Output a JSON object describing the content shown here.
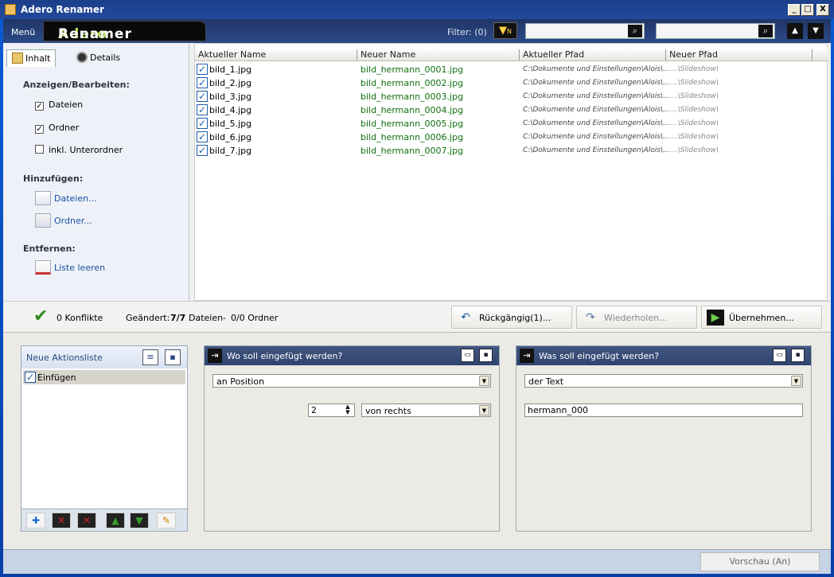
{
  "window": {
    "title": "Adero Renamer",
    "minimize": "_",
    "maximize": "□",
    "close": "X"
  },
  "topbar": {
    "menu": "Menü",
    "logo_a": "Adero",
    "logo_b": "Renamer",
    "filter_label": "Filter: (0)",
    "filter_icon": "N"
  },
  "left": {
    "tab_content": "Inhalt",
    "tab_details": "Details",
    "show_edit": "Anzeigen/Bearbeiten:",
    "checks": [
      {
        "label": "Dateien",
        "checked": "✓"
      },
      {
        "label": "Ordner",
        "checked": "✓"
      },
      {
        "label": "inkl. Unterordner",
        "checked": ""
      }
    ],
    "add": "Hinzufügen:",
    "add_files": "Dateien...",
    "add_folder": "Ordner...",
    "remove": "Entfernen:",
    "clear_list": "Liste leeren"
  },
  "table": {
    "headers": [
      "Aktueller Name",
      "Neuer Name",
      "Aktueller Pfad",
      "Neuer Pfad"
    ],
    "rows": [
      {
        "cur": "bild_1.jpg",
        "new": "bild_hermann_0001.jpg",
        "path": "C:\\Dokumente und Einstellungen\\Alois\\...",
        "npath": "...\\Slideshow\\"
      },
      {
        "cur": "bild_2.jpg",
        "new": "bild_hermann_0002.jpg",
        "path": "C:\\Dokumente und Einstellungen\\Alois\\...",
        "npath": "...\\Slideshow\\"
      },
      {
        "cur": "bild_3.jpg",
        "new": "bild_hermann_0003.jpg",
        "path": "C:\\Dokumente und Einstellungen\\Alois\\...",
        "npath": "...\\Slideshow\\"
      },
      {
        "cur": "bild_4.jpg",
        "new": "bild_hermann_0004.jpg",
        "path": "C:\\Dokumente und Einstellungen\\Alois\\...",
        "npath": "...\\Slideshow\\"
      },
      {
        "cur": "bild_5.jpg",
        "new": "bild_hermann_0005.jpg",
        "path": "C:\\Dokumente und Einstellungen\\Alois\\...",
        "npath": "...\\Slideshow\\"
      },
      {
        "cur": "bild_6.jpg",
        "new": "bild_hermann_0006.jpg",
        "path": "C:\\Dokumente und Einstellungen\\Alois\\...",
        "npath": "...\\Slideshow\\"
      },
      {
        "cur": "bild_7.jpg",
        "new": "bild_hermann_0007.jpg",
        "path": "C:\\Dokumente und Einstellungen\\Alois\\...",
        "npath": "...\\Slideshow\\"
      }
    ]
  },
  "status": {
    "conflicts": "0 Konflikte",
    "changed_label": "Geändert:",
    "changed_files_count": "7/7",
    "changed_files_word": "Dateien",
    "sep": "-",
    "changed_folders": "0/0 Ordner",
    "undo": "Rückgängig(1)...",
    "redo": "Wiederholen...",
    "apply": "Übernehmen..."
  },
  "actions": {
    "title": "Neue Aktionsliste",
    "item": "Einfügen"
  },
  "where": {
    "title": "Wo soll eingefügt werden?",
    "position": "an Position",
    "number": "2",
    "direction": "von rechts"
  },
  "what": {
    "title": "Was soll eingefügt werden?",
    "type": "der Text",
    "text": "hermann_000"
  },
  "footer": {
    "preview": "Vorschau (An)"
  }
}
